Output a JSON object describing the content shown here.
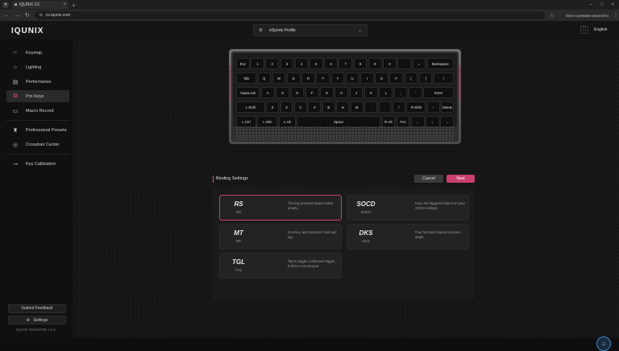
{
  "browser": {
    "tab_title": "IQUNIX ZX",
    "url": "zx.iqunix.com",
    "extension_text": "Окно в режиме инкогнито"
  },
  "app": {
    "logo": "IQUNIX",
    "language": "English"
  },
  "profile": {
    "label": "eSports Profile"
  },
  "sidebar": {
    "items": [
      {
        "label": "Keymap",
        "icon": "keymap-icon"
      },
      {
        "label": "Lighting",
        "icon": "lighting-icon"
      },
      {
        "label": "Performance",
        "icon": "performance-icon"
      },
      {
        "label": "Pro Keys",
        "icon": "pro-keys-icon",
        "active": true
      },
      {
        "label": "Macro Record",
        "icon": "macro-icon"
      },
      {
        "label": "Professional Presets",
        "icon": "presets-icon"
      },
      {
        "label": "Crosshair Center",
        "icon": "crosshair-icon"
      },
      {
        "label": "Key Calibration",
        "icon": "calibration-icon"
      }
    ],
    "feedback": "Submit Feedback",
    "settings": "Settings",
    "firmware": "IQUNIX FIRMWARE 1.0.8"
  },
  "keyboard": {
    "rows": [
      [
        "Esc",
        "1",
        "2",
        "3",
        "4",
        "5",
        "6",
        "7",
        "8",
        "9",
        "0",
        "-",
        "=",
        "Backspace"
      ],
      [
        "Tab",
        "Q",
        "W",
        "E",
        "R",
        "T",
        "Y",
        "U",
        "I",
        "O",
        "P",
        "[",
        "]",
        "\\"
      ],
      [
        "CapsLock",
        "A",
        "S",
        "D",
        "F",
        "G",
        "H",
        "J",
        "K",
        "L",
        ";",
        "'",
        "Enter"
      ],
      [
        "L-Shift",
        "Z",
        "X",
        "C",
        "V",
        "B",
        "N",
        "M",
        ",",
        ".",
        "/",
        "R-Shift",
        "↑",
        "Delete"
      ],
      [
        "L-Ctrl",
        "L-Win",
        "L-Alt",
        "Space",
        "R-Alt",
        "Fn1",
        "←",
        "↓",
        "→"
      ]
    ]
  },
  "binding": {
    "title": "Binding Settings",
    "cancel": "Cancel",
    "next": "Next",
    "cards": [
      {
        "code": "RS",
        "sub": "RS",
        "desc": "The key pressed deeper takes priority.",
        "selected": true
      },
      {
        "code": "SOCD",
        "sub": "SOCD",
        "desc": "Keys are triggered based on your SOCD settings"
      },
      {
        "code": "MT",
        "sub": "MT",
        "desc": "One key, two functions: hold and tap."
      },
      {
        "code": "DKS",
        "sub": "DKS",
        "desc": "Four functions based on press depth"
      },
      {
        "code": "TGL",
        "sub": "TGL",
        "desc": "Tap to toggle continuous trigger, hold for normal input"
      }
    ]
  }
}
